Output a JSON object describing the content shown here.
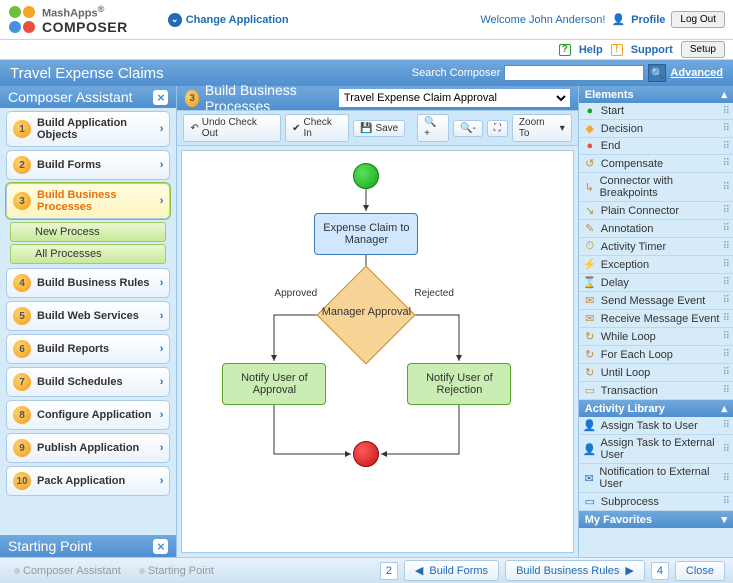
{
  "brand": {
    "line1": "MashApps",
    "line2": "COMPOSER",
    "reg": "®"
  },
  "change_app": "Change Application",
  "welcome_prefix": "Welcome ",
  "username": "John Anderson",
  "welcome_suffix": "!",
  "profile": "Profile",
  "logout": "Log Out",
  "help": "Help",
  "support": "Support",
  "setup": "Setup",
  "app_title": "Travel Expense Claims",
  "search_label": "Search Composer",
  "advanced": "Advanced",
  "assistant_title": "Composer Assistant",
  "starting_point_title": "Starting Point",
  "steps": [
    {
      "n": "1",
      "label": "Build Application Objects"
    },
    {
      "n": "2",
      "label": "Build Forms"
    },
    {
      "n": "3",
      "label": "Build Business Processes",
      "active": true,
      "subs": [
        "New Process",
        "All Processes"
      ]
    },
    {
      "n": "4",
      "label": "Build Business Rules"
    },
    {
      "n": "5",
      "label": "Build Web Services"
    },
    {
      "n": "6",
      "label": "Build Reports"
    },
    {
      "n": "7",
      "label": "Build Schedules"
    },
    {
      "n": "8",
      "label": "Configure Application"
    },
    {
      "n": "9",
      "label": "Publish Application"
    },
    {
      "n": "10",
      "label": "Pack Application"
    }
  ],
  "center": {
    "num": "3",
    "title": "Build Business Processes",
    "dropdown_value": "Travel Expense Claim Approval"
  },
  "toolbar": {
    "undo": "Undo Check Out",
    "checkin": "Check In",
    "save": "Save",
    "zoom": "Zoom To"
  },
  "flow": {
    "box1": "Expense Claim to Manager",
    "diamond": "Manager Approval",
    "box2": "Notify User of Approval",
    "box3": "Notify User of Rejection",
    "edge_left": "Approved",
    "edge_right": "Rejected"
  },
  "elements_hdr": "Elements",
  "elements": [
    {
      "label": "Start",
      "icon": "●",
      "cls": "ic-start"
    },
    {
      "label": "Decision",
      "icon": "◆",
      "cls": "ic-dec"
    },
    {
      "label": "End",
      "icon": "●",
      "cls": "ic-end"
    },
    {
      "label": "Compensate",
      "icon": "↺",
      "cls": "ic-gen"
    },
    {
      "label": "Connector with Breakpoints",
      "icon": "↳",
      "cls": "ic-gen"
    },
    {
      "label": "Plain Connector",
      "icon": "↘",
      "cls": "ic-gen"
    },
    {
      "label": "Annotation",
      "icon": "✎",
      "cls": "ic-gen"
    },
    {
      "label": "Activity Timer",
      "icon": "⏱",
      "cls": "ic-gen"
    },
    {
      "label": "Exception",
      "icon": "⚡",
      "cls": "ic-gen"
    },
    {
      "label": "Delay",
      "icon": "⌛",
      "cls": "ic-gen"
    },
    {
      "label": "Send Message Event",
      "icon": "✉",
      "cls": "ic-gen"
    },
    {
      "label": "Receive Message Event",
      "icon": "✉",
      "cls": "ic-gen"
    },
    {
      "label": "While Loop",
      "icon": "↻",
      "cls": "ic-gen"
    },
    {
      "label": "For Each Loop",
      "icon": "↻",
      "cls": "ic-gen"
    },
    {
      "label": "Until Loop",
      "icon": "↻",
      "cls": "ic-gen"
    },
    {
      "label": "Transaction",
      "icon": "▭",
      "cls": "ic-gen"
    }
  ],
  "activity_hdr": "Activity Library",
  "activities": [
    {
      "label": "Assign Task to User",
      "icon": "👤",
      "cls": "ic-blue"
    },
    {
      "label": "Assign Task to External User",
      "icon": "👤",
      "cls": "ic-blue"
    },
    {
      "label": "Notification to External User",
      "icon": "✉",
      "cls": "ic-blue"
    },
    {
      "label": "Subprocess",
      "icon": "▭",
      "cls": "ic-blue"
    }
  ],
  "fav_hdr": "My Favorites",
  "bottom": {
    "tab1": "Composer Assistant",
    "tab2": "Starting Point",
    "prev_num": "2",
    "prev_label": "Build Forms",
    "next_label": "Build Business Rules",
    "next_num": "4",
    "close": "Close"
  }
}
